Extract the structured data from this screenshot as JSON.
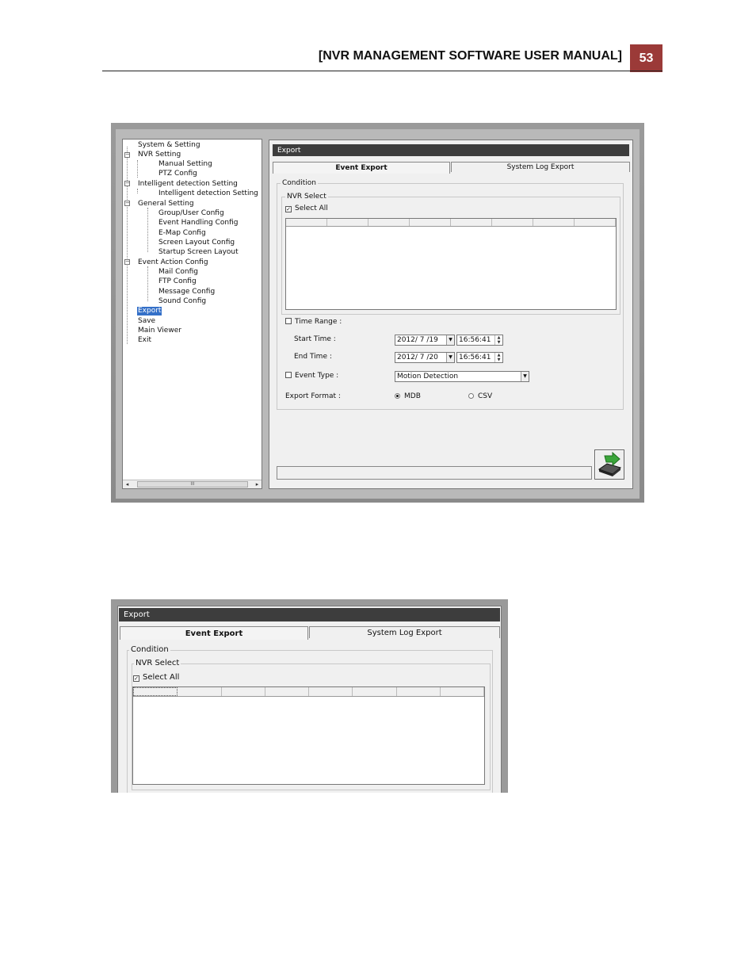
{
  "header": {
    "title": "[NVR MANAGEMENT SOFTWARE USER MANUAL]",
    "page_number": "53"
  },
  "tree": {
    "items": [
      "System & Setting",
      "NVR  Setting",
      "Manual Setting",
      "PTZ Config",
      "Intelligent detection Setting",
      "Intelligent detection Setting",
      "General Setting",
      "Group/User Config",
      "Event Handling Config",
      "E-Map Config",
      "Screen Layout Config",
      "Startup Screen Layout",
      "Event Action Config",
      "Mail Config",
      "FTP Config",
      "Message Config",
      "Sound Config",
      "Export",
      "Save",
      "Main Viewer",
      "Exit"
    ],
    "selected": "Export",
    "scroll_thumb": "III"
  },
  "export": {
    "title": "Export",
    "tabs": [
      "Event Export",
      "System Log Export"
    ],
    "condition_label": "Condition",
    "nvr_select_label": "NVR Select",
    "select_all_label": "Select All",
    "select_all_mark": "✓",
    "time_range_label": "Time Range :",
    "start_time_label": "Start Time :",
    "start_date": "2012/ 7 /19",
    "start_clock": "16:56:41",
    "end_time_label": "End Time :",
    "end_date": "2012/ 7 /20",
    "end_clock": "16:56:41",
    "event_type_label": "Event Type :",
    "event_type_value": "Motion Detection",
    "export_format_label": "Export Format :",
    "formats": [
      "MDB",
      "CSV"
    ],
    "selected_format": "MDB"
  }
}
